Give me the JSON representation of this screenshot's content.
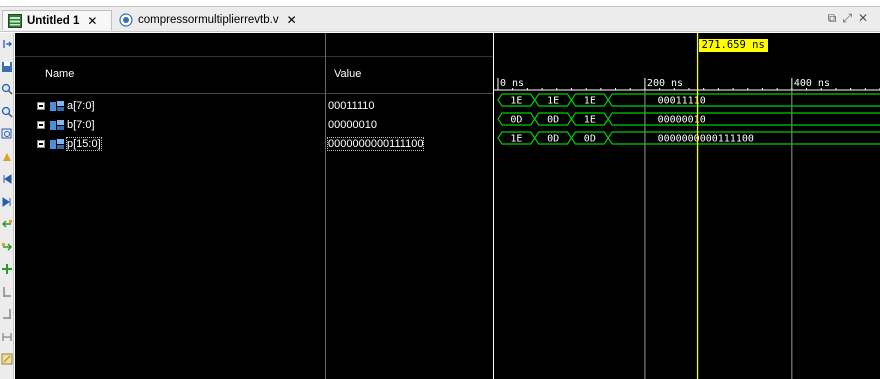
{
  "tabs": [
    {
      "label": "Untitled 1",
      "active": true
    },
    {
      "label": "compressormultiplierrevtb.v",
      "active": false
    }
  ],
  "columns": {
    "name": "Name",
    "value": "Value"
  },
  "signals": [
    {
      "name": "a[7:0]",
      "value": "00011110"
    },
    {
      "name": "b[7:0]",
      "value": "00000010"
    },
    {
      "name": "p[15:0]",
      "value": "0000000000111100"
    }
  ],
  "ruler": {
    "labels": [
      "0 ns",
      "200 ns",
      "400 ns"
    ],
    "ticks_ns": [
      0,
      200,
      400
    ],
    "minor_step_ns": 20,
    "view_end_ns": 520
  },
  "cursor": {
    "label": "271.659 ns",
    "time_ns": 271.659
  },
  "waves": [
    {
      "signal": "a[7:0]",
      "segments": [
        {
          "start": 0,
          "end": 50,
          "text": "1E"
        },
        {
          "start": 50,
          "end": 100,
          "text": "1E"
        },
        {
          "start": 100,
          "end": 150,
          "text": "1E"
        },
        {
          "start": 150,
          "end": 520,
          "text": "00011110"
        }
      ]
    },
    {
      "signal": "b[7:0]",
      "segments": [
        {
          "start": 0,
          "end": 50,
          "text": "0D"
        },
        {
          "start": 50,
          "end": 100,
          "text": "0D"
        },
        {
          "start": 100,
          "end": 150,
          "text": "1E"
        },
        {
          "start": 150,
          "end": 520,
          "text": "00000010"
        }
      ]
    },
    {
      "signal": "p[15:0]",
      "segments": [
        {
          "start": 0,
          "end": 50,
          "text": "1E"
        },
        {
          "start": 50,
          "end": 100,
          "text": "0D"
        },
        {
          "start": 100,
          "end": 150,
          "text": "0D"
        },
        {
          "start": 150,
          "end": 520,
          "text": "0000000000111100"
        }
      ]
    }
  ],
  "colors": {
    "wave": "#00d000",
    "cursor": "#ffff00",
    "grid": "#9a9a9a",
    "background": "#000000"
  },
  "toolbar_icons": [
    "fit-icon",
    "save-icon",
    "zoom-in-icon",
    "zoom-out-icon",
    "zoom-fit-icon",
    "go-to-cursor-icon",
    "go-to-start-icon",
    "go-to-end-icon",
    "previous-transition-icon",
    "next-transition-icon",
    "add-marker-icon",
    "previous-marker-icon",
    "next-marker-icon",
    "swap-cursors-icon",
    "snap-to-transition-icon"
  ]
}
